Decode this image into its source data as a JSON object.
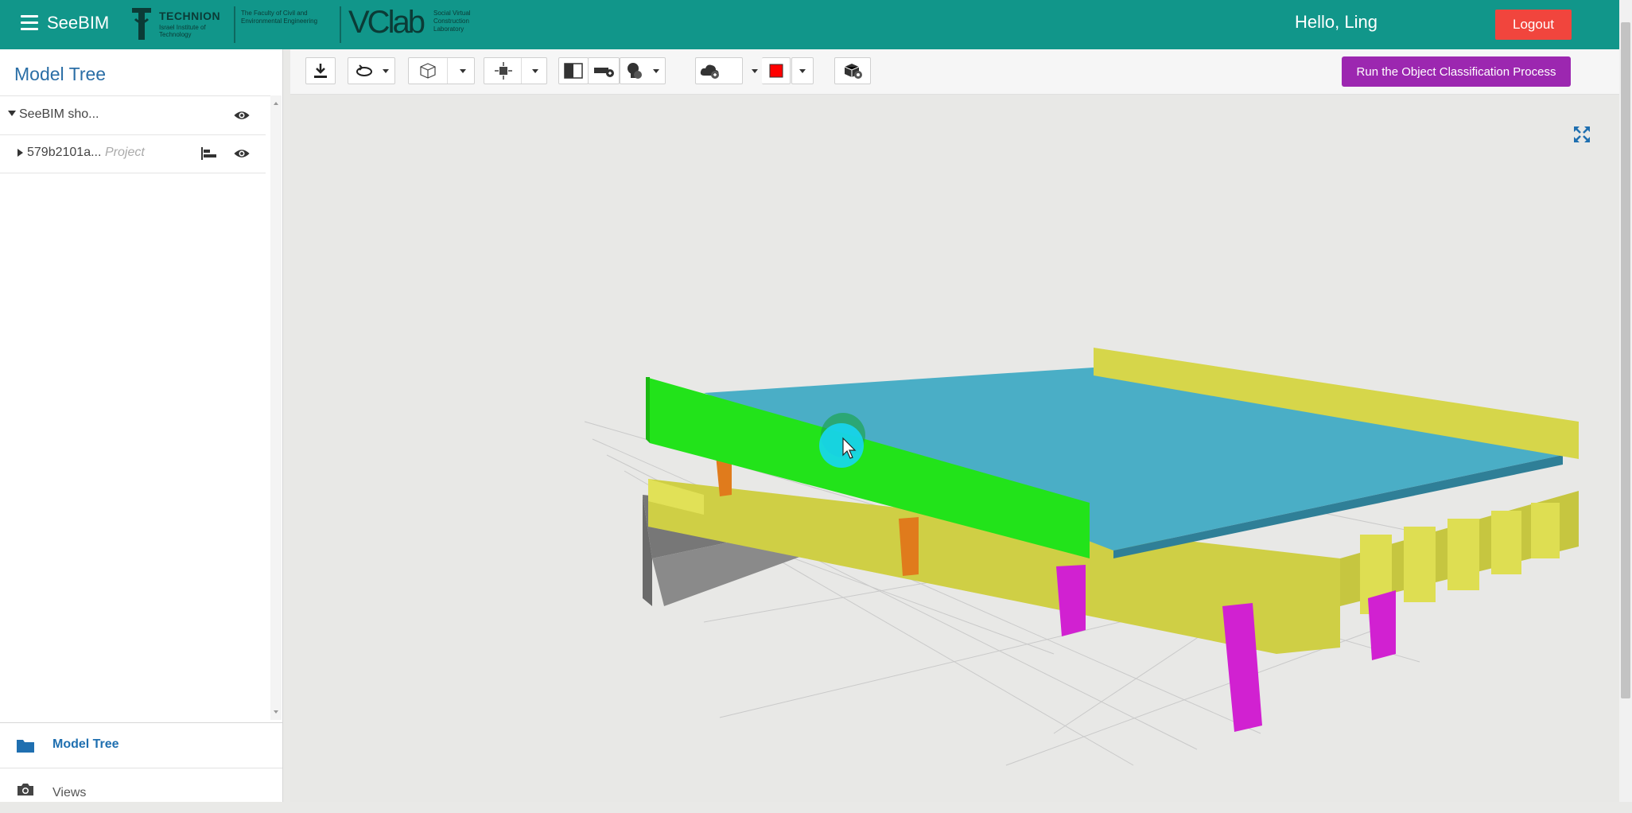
{
  "header": {
    "app_name": "SeeBIM",
    "logos": {
      "technion_name": "TECHNION",
      "technion_sub": "Israel Institute of Technology",
      "faculty": "The Faculty of Civil and Environmental Engineering",
      "vclab": "VClab",
      "vclab_sub": "Social Virtual Construction Laboratory"
    },
    "greeting": "Hello, Ling",
    "logout_label": "Logout"
  },
  "sidebar": {
    "title": "Model Tree",
    "tree": [
      {
        "label": "SeeBIM sho...",
        "type": "",
        "expanded": true
      },
      {
        "label": "579b2101a...",
        "type": "Project",
        "expanded": false
      }
    ],
    "nav": [
      {
        "label": "Model Tree",
        "icon": "folder-icon",
        "active": true
      },
      {
        "label": "Views",
        "icon": "camera-icon",
        "active": false
      }
    ]
  },
  "toolbar": {
    "run_label": "Run the Object Classification Process",
    "color_swatch": "#ff0000"
  },
  "colors": {
    "header": "#11968a",
    "logout": "#f1453d",
    "run_button": "#9c27b0",
    "title": "#2a6ea6",
    "deck": "#4aaec6",
    "green_parapet": "#22e31a",
    "yellow_parapet": "#d6d64a",
    "columns": "#d121d1",
    "bearings": "#e07b1c",
    "abutment": "#7a7a7a"
  }
}
